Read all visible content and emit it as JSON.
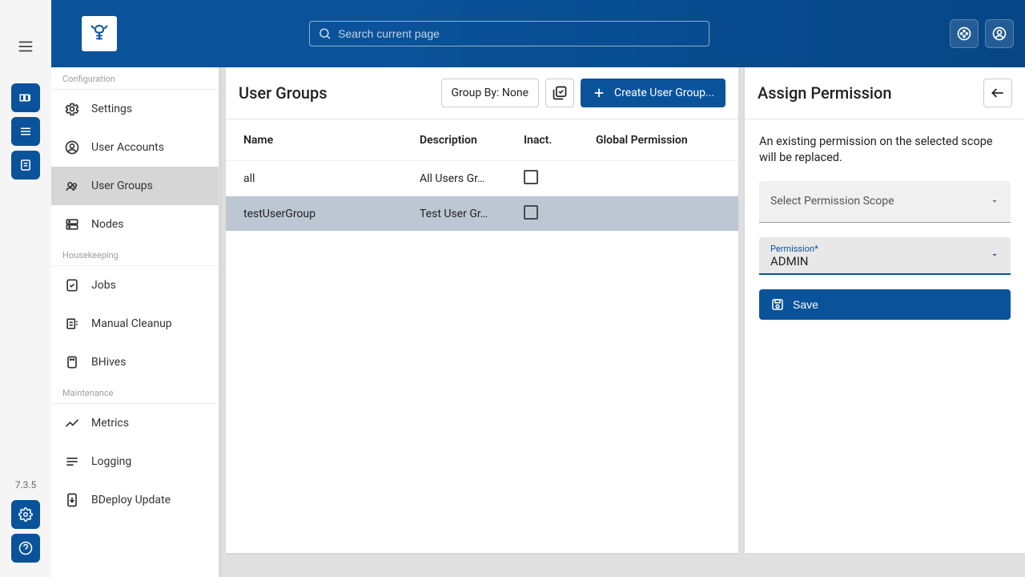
{
  "rail": {
    "version": "7.3.5"
  },
  "topbar": {
    "search_placeholder": "Search current page"
  },
  "nav": {
    "sections": [
      {
        "label": "Configuration",
        "items": [
          "Settings",
          "User Accounts",
          "User Groups",
          "Nodes"
        ]
      },
      {
        "label": "Housekeeping",
        "items": [
          "Jobs",
          "Manual Cleanup",
          "BHives"
        ]
      },
      {
        "label": "Maintenance",
        "items": [
          "Metrics",
          "Logging",
          "BDeploy Update"
        ]
      }
    ],
    "active": "User Groups"
  },
  "main": {
    "title": "User Groups",
    "group_by_label": "Group By: None",
    "create_label": "Create User Group...",
    "columns": {
      "name": "Name",
      "description": "Description",
      "inactive": "Inact.",
      "global_permission": "Global Permission"
    },
    "rows": [
      {
        "name": "all",
        "description": "All Users Gr…",
        "inactive": false,
        "global_permission": "",
        "selected": false
      },
      {
        "name": "testUserGroup",
        "description": "Test User Gr…",
        "inactive": false,
        "global_permission": "",
        "selected": true
      }
    ]
  },
  "side": {
    "title": "Assign Permission",
    "info": "An existing permission on the selected scope will be replaced.",
    "scope_placeholder": "Select Permission Scope",
    "perm_label": "Permission*",
    "perm_value": "ADMIN",
    "save_label": "Save"
  }
}
